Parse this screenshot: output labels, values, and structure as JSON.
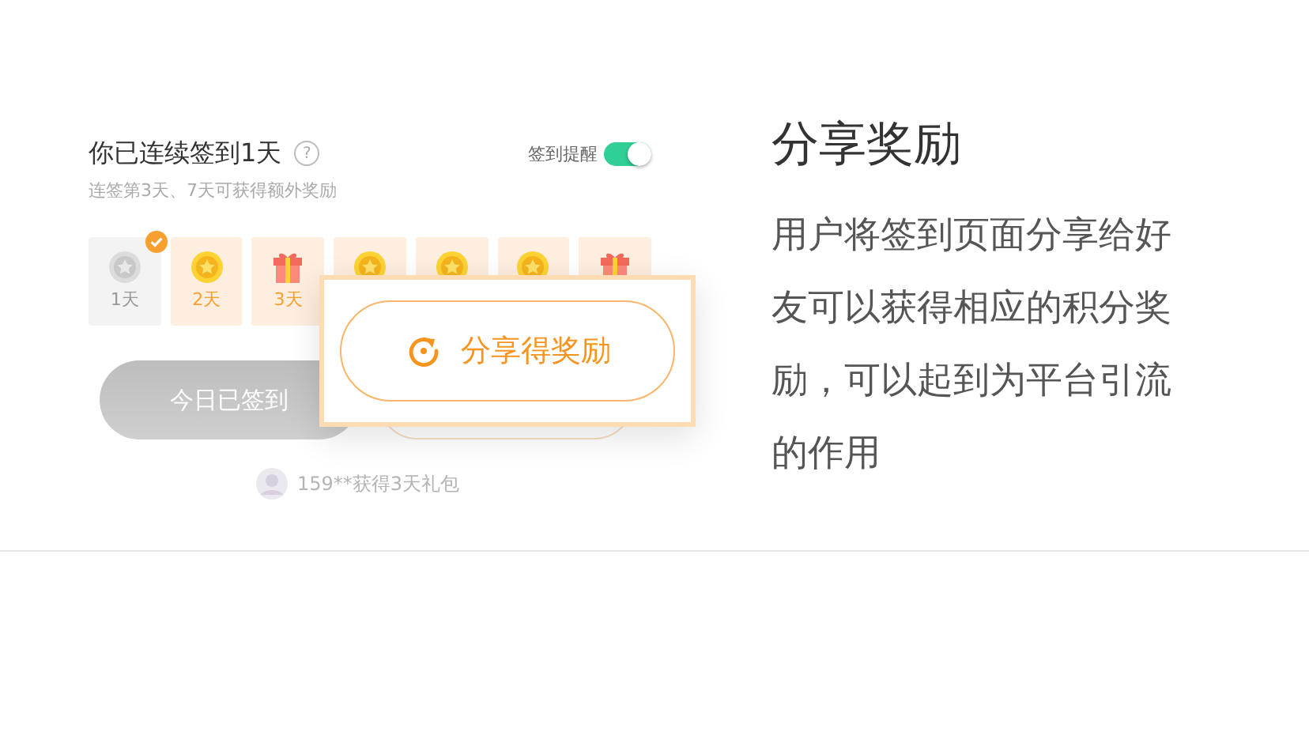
{
  "checkin": {
    "title": "你已连续签到1天",
    "help": "?",
    "reminder": {
      "label": "签到提醒",
      "on": true
    },
    "subtitle": "连签第3天、7天可获得额外奖励",
    "days": [
      {
        "kind": "star",
        "label": "1天",
        "checked": true
      },
      {
        "kind": "coin",
        "label": "2天",
        "checked": false
      },
      {
        "kind": "gift",
        "label": "3天",
        "checked": false
      },
      {
        "kind": "coin",
        "checked": false
      },
      {
        "kind": "coin",
        "checked": false
      },
      {
        "kind": "coin",
        "checked": false
      },
      {
        "kind": "gift",
        "checked": false
      }
    ],
    "signed_button": "今日已签到",
    "share_popup": {
      "button": "分享得奖励"
    },
    "notice": "159**获得3天礼包"
  },
  "description": {
    "title": "分享奖励",
    "text": "用户将签到页面分享给好友可以获得相应的积分奖励，可以起到为平台引流的作用"
  }
}
